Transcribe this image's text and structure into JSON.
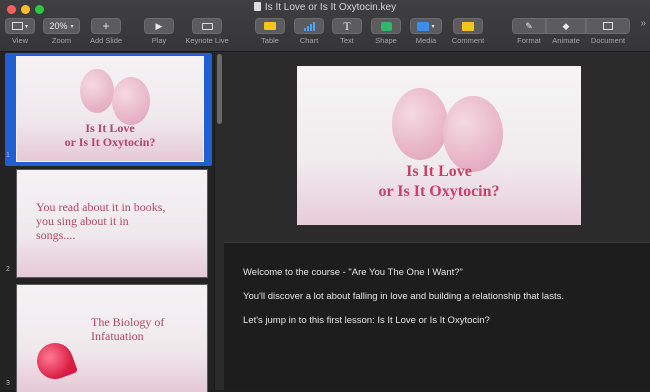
{
  "window": {
    "title": "Is It Love or Is It Oxytocin.key"
  },
  "toolbar": {
    "view": "View",
    "zoom": "Zoom",
    "zoom_value": "20%",
    "add_slide": "Add Slide",
    "play": "Play",
    "keynote_live": "Keynote Live",
    "table": "Table",
    "chart": "Chart",
    "text": "Text",
    "shape": "Shape",
    "media": "Media",
    "comment": "Comment",
    "format": "Format",
    "animate": "Animate",
    "document": "Document",
    "overflow": "»"
  },
  "slides": [
    {
      "number": "1",
      "line1": "Is It Love",
      "line2": "or Is It Oxytocin?"
    },
    {
      "number": "2",
      "line1": "You read about it in books,",
      "line2": "you sing about it in",
      "line3": "songs...."
    },
    {
      "number": "3",
      "line1": "The Biology of",
      "line2": "Infatuation"
    }
  ],
  "current_slide": {
    "title1": "Is It Love",
    "title2": "or Is It Oxytocin?"
  },
  "notes": [
    "Welcome to the course - \"Are You The One I Want?\"",
    "You'll discover a lot about falling in love and building a relationship that lasts.",
    "Let's jump in to this first lesson: Is It Love or Is It Oxytocin?"
  ],
  "colors": {
    "accent": "#1f5fd1",
    "title_pink": "#c8416b",
    "balloon": "#e9b3c6"
  }
}
